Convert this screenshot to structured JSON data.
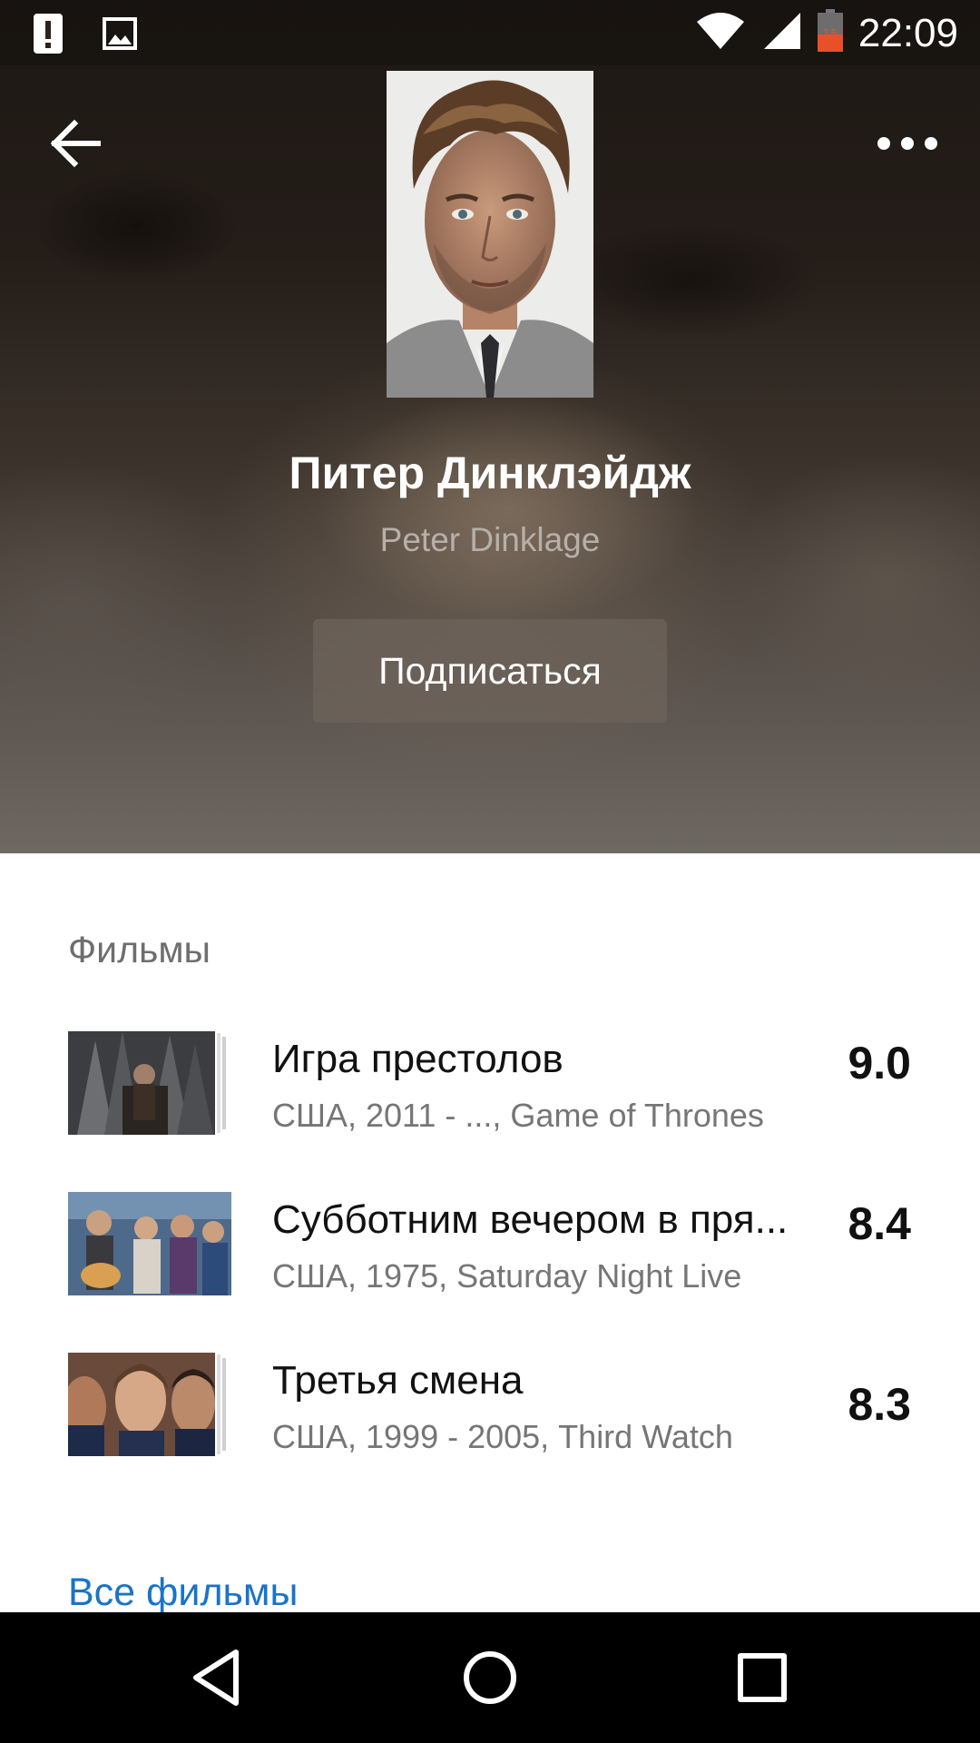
{
  "status_bar": {
    "time": "22:09",
    "battery_level": "15",
    "icons": [
      "alert-icon",
      "image-icon",
      "wifi-icon",
      "signal-icon",
      "battery-icon"
    ]
  },
  "toolbar": {
    "back_icon": "arrow-left-icon",
    "more_icon": "more-horizontal-icon"
  },
  "person": {
    "name_ru": "Питер Динклэйдж",
    "name_en": "Peter Dinklage",
    "subscribe_label": "Подписаться"
  },
  "films": {
    "section_title": "Фильмы",
    "items": [
      {
        "title": "Игра престолов",
        "meta": "США, 2011 - ..., Game of Thrones",
        "rating": "9.0"
      },
      {
        "title": "Субботним вечером в пря...",
        "meta": "США, 1975, Saturday Night Live",
        "rating": "8.4"
      },
      {
        "title": "Третья смена",
        "meta": "США, 1999 - 2005, Third Watch",
        "rating": "8.3"
      }
    ],
    "all_label": "Все фильмы"
  },
  "nav_bar": {
    "icons": [
      "back-triangle-icon",
      "home-circle-icon",
      "recents-square-icon"
    ]
  },
  "colors": {
    "link": "#1a73c8",
    "rating": "#111111",
    "meta": "#767676"
  }
}
